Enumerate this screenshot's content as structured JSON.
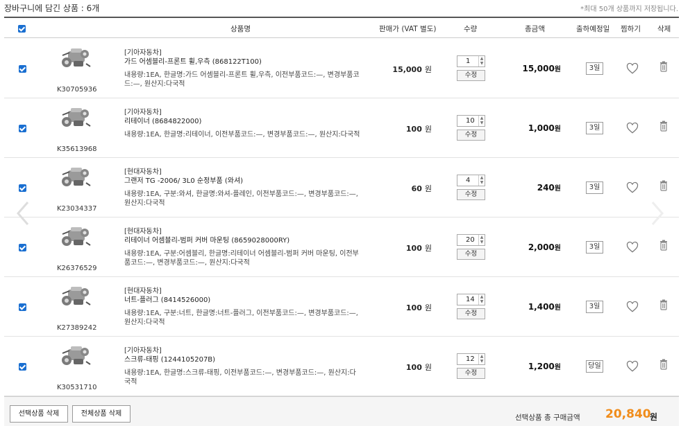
{
  "header": {
    "title": "장바구니에 담긴 상품 : 6개",
    "notice": "*최대 50개 상품까지 저장됩니다."
  },
  "columns": {
    "product": "상품명",
    "price": "판매가 (VAT 별도)",
    "qty": "수량",
    "total": "총금액",
    "ship": "출하예정일",
    "wish": "찜하기",
    "delete": "삭제"
  },
  "labels": {
    "modify": "수정",
    "won": "원"
  },
  "items": [
    {
      "code": "K30705936",
      "brand": "[기아자동차]",
      "name": "가드 어셈블리-프론트 휠,우측 (868122T100)",
      "desc": "내용량:1EA, 한글명:가드 어셈블리-프론트 휠,우측, 이전부품코드:—, 변경부품코드:—, 원산지:다국적",
      "price": "15,000",
      "qty": "1",
      "total": "15,000",
      "ship": "3일"
    },
    {
      "code": "K35613968",
      "brand": "[기아자동차]",
      "name": "리테이너 (8684822000)",
      "desc": "내용량:1EA, 한글명:리테이너, 이전부품코드:—, 변경부품코드:—, 원산지:다국적",
      "price": "100",
      "qty": "10",
      "total": "1,000",
      "ship": "3일"
    },
    {
      "code": "K23034337",
      "brand": "[현대자동차]",
      "name": "그랜저 TG -2006/ 3L0 순정부품 (와셔)",
      "desc": "내용량:1EA, 구분:와셔, 한글명:와셔-플레인, 이전부품코드:—, 변경부품코드:—, 원산지:다국적",
      "price": "60",
      "qty": "4",
      "total": "240",
      "ship": "3일"
    },
    {
      "code": "K26376529",
      "brand": "[현대자동차]",
      "name": "리테이너 어셈블리-범퍼 커버 마운팅 (8659028000RY)",
      "desc": "내용량:1EA, 구분:어셈블리, 한글명:리테이너 어셈블리-범퍼 커버 마운팅, 이전부품코드:—, 변경부품코드:—, 원산지:다국적",
      "price": "100",
      "qty": "20",
      "total": "2,000",
      "ship": "3일"
    },
    {
      "code": "K27389242",
      "brand": "[현대자동차]",
      "name": "너트-플러그 (8414526000)",
      "desc": "내용량:1EA, 구분:너트, 한글명:너트-플러그, 이전부품코드:—, 변경부품코드:—, 원산지:다국적",
      "price": "100",
      "qty": "14",
      "total": "1,400",
      "ship": "3일"
    },
    {
      "code": "K30531710",
      "brand": "[기아자동차]",
      "name": "스크류-태핑 (1244105207B)",
      "desc": "내용량:1EA, 한글명:스크류-태핑, 이전부품코드:—, 변경부품코드:—, 원산지:다국적",
      "price": "100",
      "qty": "12",
      "total": "1,200",
      "ship": "당일"
    }
  ],
  "footer": {
    "delete_selected": "선택상품 삭제",
    "delete_all": "전체상품 삭제",
    "sum_label": "선택상품 총 구매금액",
    "sum_value": "20,840",
    "sum_unit": "원"
  },
  "colors": {
    "checkbox": "#1a6fd1",
    "accent": "#f08c1a"
  }
}
